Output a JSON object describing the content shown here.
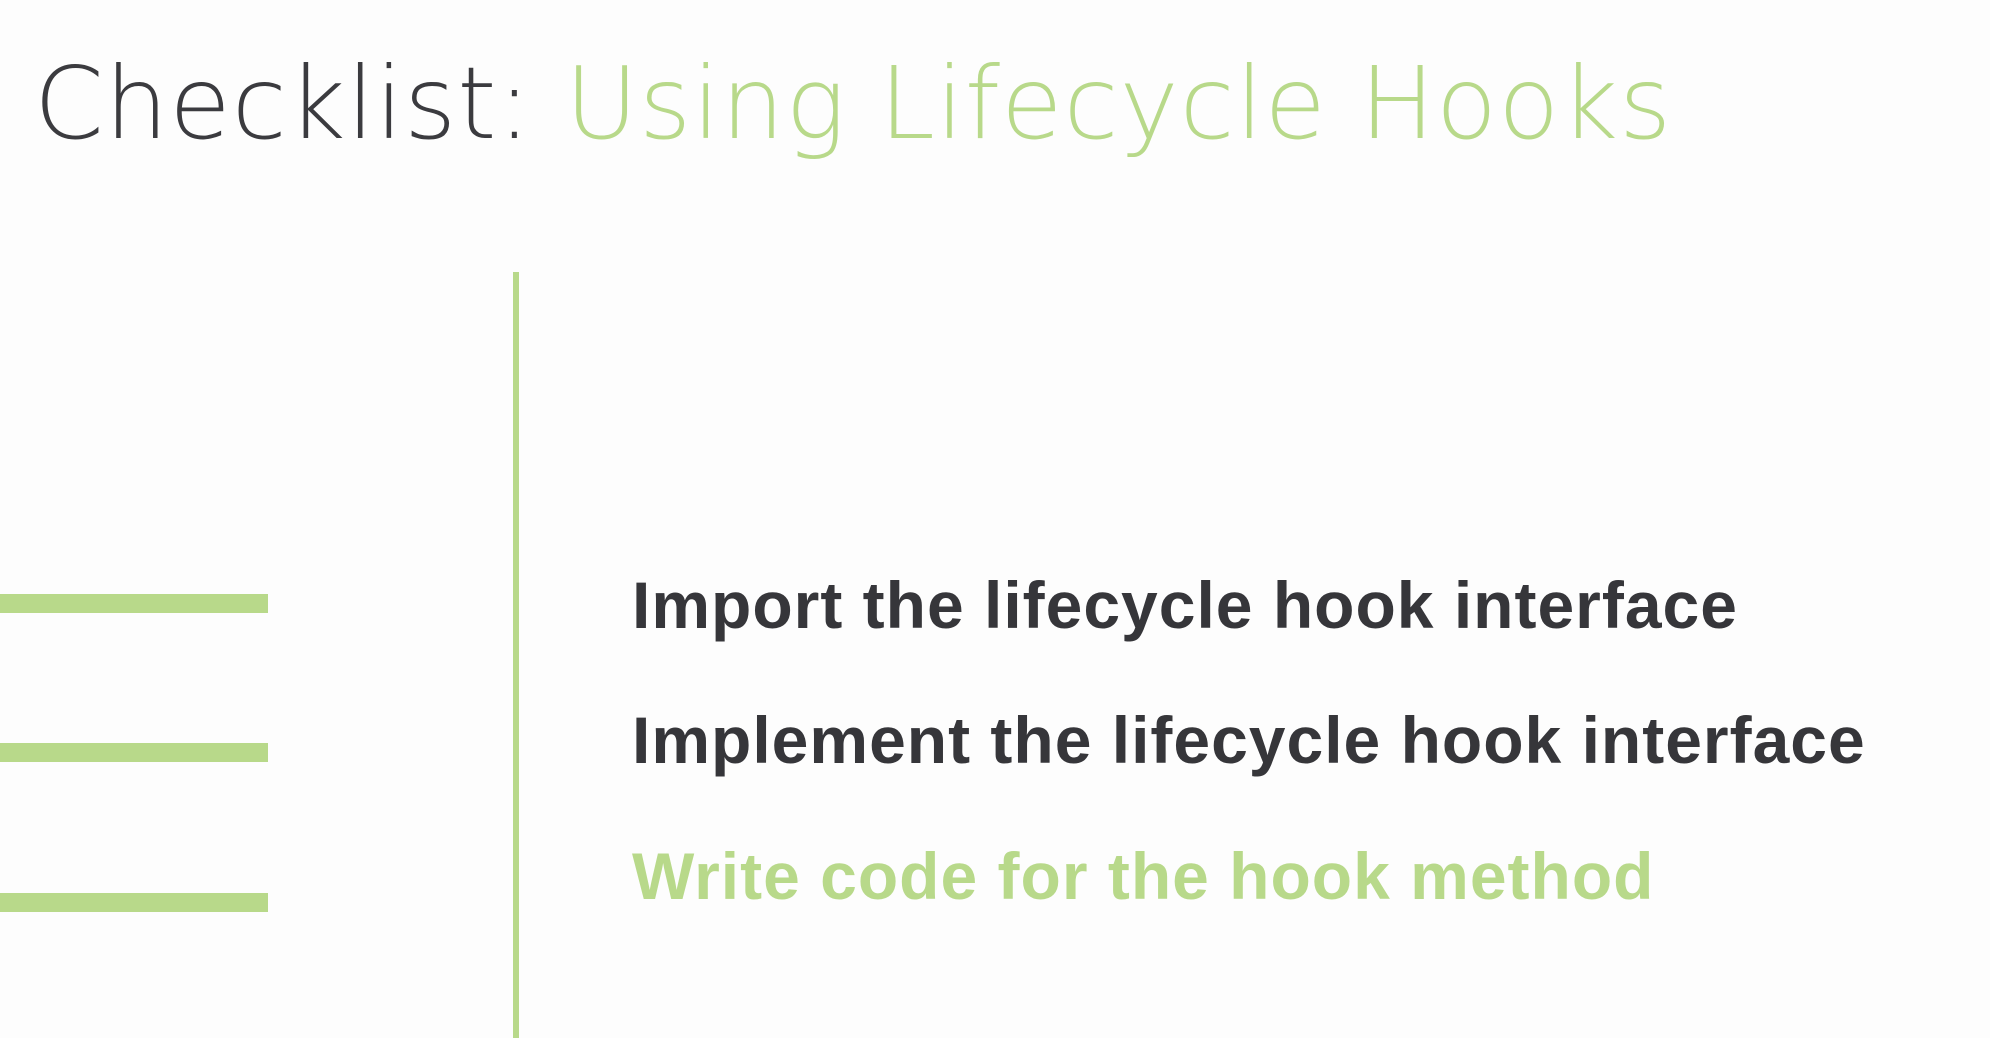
{
  "slide": {
    "title_prefix": "Checklist: ",
    "title_highlight": "Using Lifecycle Hooks",
    "checklist": [
      {
        "text": "Import the lifecycle hook interface",
        "state": "done"
      },
      {
        "text": "Implement the lifecycle hook interface",
        "state": "done"
      },
      {
        "text": "Write code for the hook method",
        "state": "current"
      }
    ]
  },
  "colors": {
    "accent": "#b8d98a",
    "text": "#36363a",
    "background": "#fdfdfd"
  }
}
